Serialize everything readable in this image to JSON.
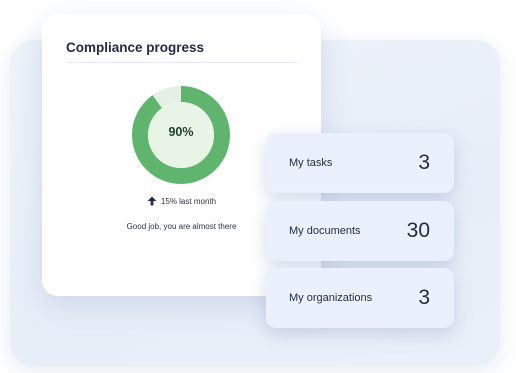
{
  "compliance_card": {
    "title": "Compliance progress",
    "progress_percent": 90,
    "progress_label": "90%",
    "delta_text": "15% last month",
    "delta_icon": "arrow-up-icon",
    "message": "Good job, you are almost there",
    "colors": {
      "ring": "#5fb56e",
      "ring_track": "#e4f0e3",
      "inner_fill": "#e8f4e6"
    }
  },
  "stats": [
    {
      "label": "My tasks",
      "value": "3"
    },
    {
      "label": "My documents",
      "value": "30"
    },
    {
      "label": "My organizations",
      "value": "3"
    }
  ]
}
